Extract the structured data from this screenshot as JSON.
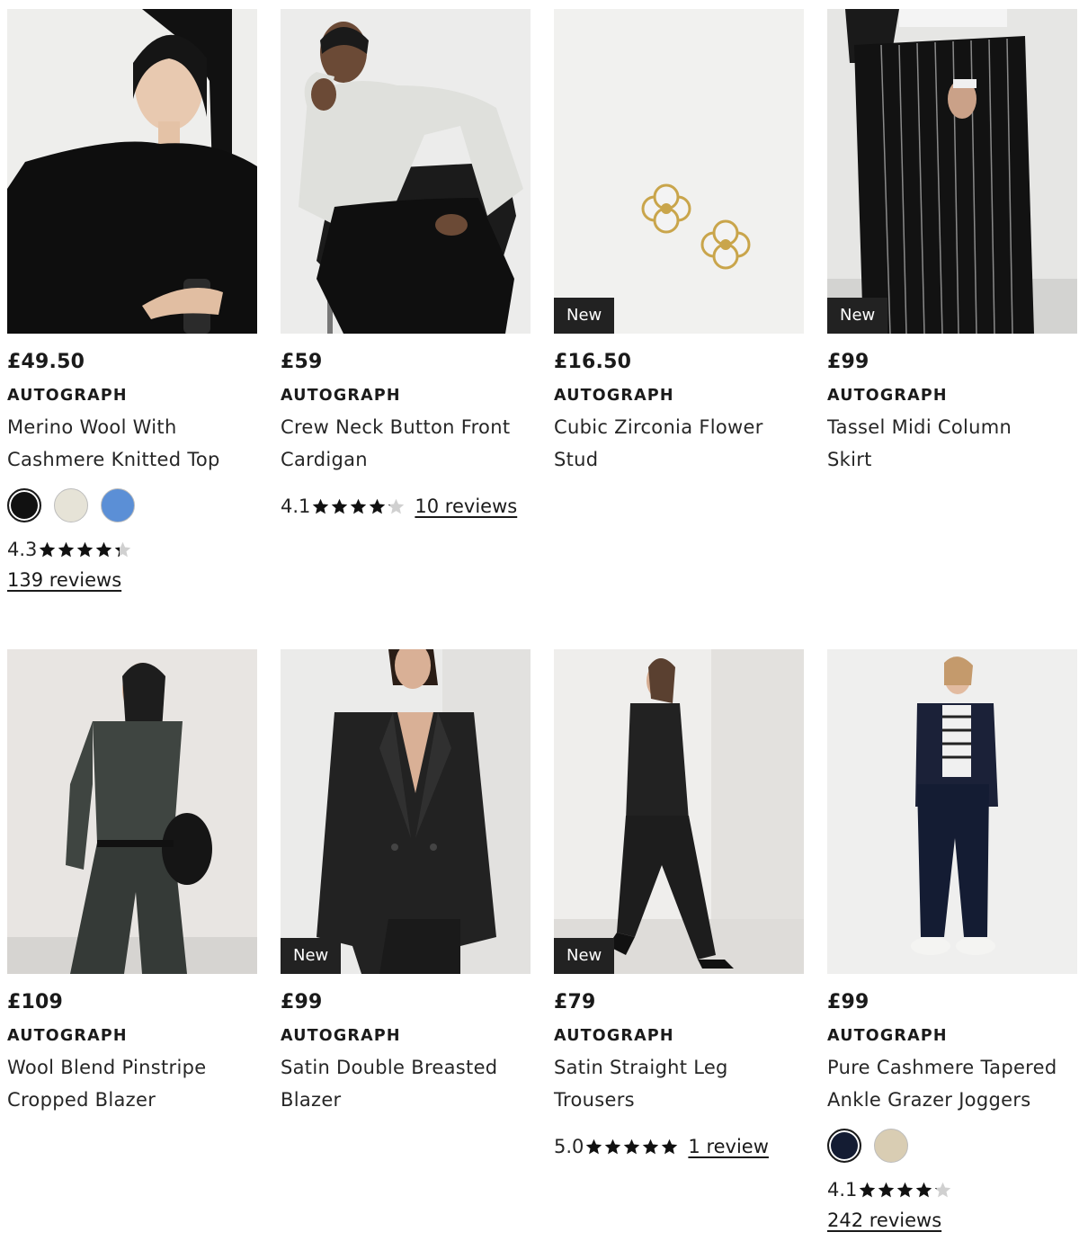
{
  "products": [
    {
      "price": "£49.50",
      "brand": "AUTOGRAPH",
      "name_line1": "Merino Wool With",
      "name_line2": "Cashmere Knitted Top",
      "badge": "",
      "swatches": [
        "#111111",
        "#e6e3d7",
        "#5b8fd6"
      ],
      "rating": "4.3",
      "stars": 4.3,
      "reviews": "139 reviews"
    },
    {
      "price": "£59",
      "brand": "AUTOGRAPH",
      "name_line1": "Crew Neck Button Front",
      "name_line2": "Cardigan",
      "badge": "",
      "rating": "4.1",
      "stars": 4.1,
      "reviews": "10 reviews"
    },
    {
      "price": "£16.50",
      "brand": "AUTOGRAPH",
      "name_line1": "Cubic Zirconia Flower",
      "name_line2": "Stud",
      "badge": "New"
    },
    {
      "price": "£99",
      "brand": "AUTOGRAPH",
      "name_line1": "Tassel Midi Column",
      "name_line2": "Skirt",
      "badge": "New"
    },
    {
      "price": "£109",
      "brand": "AUTOGRAPH",
      "name_line1": "Wool Blend Pinstripe",
      "name_line2": "Cropped Blazer",
      "badge": ""
    },
    {
      "price": "£99",
      "brand": "AUTOGRAPH",
      "name_line1": "Satin Double Breasted",
      "name_line2": "Blazer",
      "badge": "New"
    },
    {
      "price": "£79",
      "brand": "AUTOGRAPH",
      "name_line1": "Satin Straight Leg",
      "name_line2": "Trousers",
      "badge": "New",
      "rating": "5.0",
      "stars": 5,
      "reviews": "1 review"
    },
    {
      "price": "£99",
      "brand": "AUTOGRAPH",
      "name_line1": "Pure Cashmere Tapered",
      "name_line2": "Ankle Grazer Joggers",
      "badge": "",
      "swatches": [
        "#141c33",
        "#d9cdb3"
      ],
      "rating": "4.1",
      "stars": 4.1,
      "reviews": "242 reviews"
    }
  ]
}
